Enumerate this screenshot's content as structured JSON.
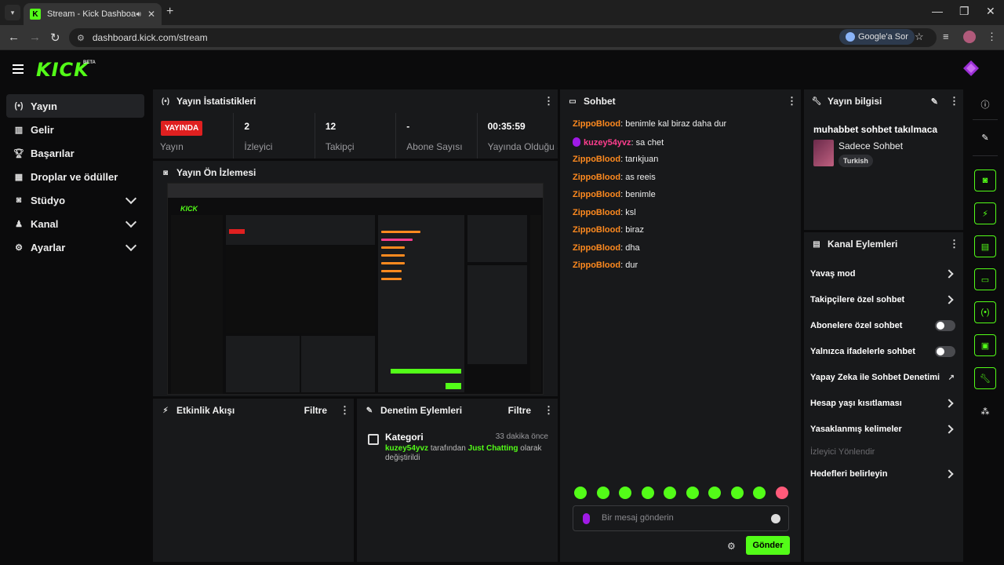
{
  "browser": {
    "tab_title": "Stream - Kick Dashboard",
    "url": "dashboard.kick.com/stream",
    "google_ask": "Google'a Sor"
  },
  "brand": {
    "logo": "KICK",
    "beta": "BETA",
    "accent": "#53fc18",
    "live_color": "#e02020"
  },
  "sidebar": {
    "items": [
      {
        "label": "Yayın",
        "icon": "broadcast-icon"
      },
      {
        "label": "Gelir",
        "icon": "chart-icon"
      },
      {
        "label": "Başarılar",
        "icon": "trophy-icon"
      },
      {
        "label": "Droplar ve ödüller",
        "icon": "gift-icon"
      },
      {
        "label": "Stüdyo",
        "icon": "studio-icon"
      },
      {
        "label": "Kanal",
        "icon": "users-icon"
      },
      {
        "label": "Ayarlar",
        "icon": "gear-icon"
      }
    ]
  },
  "stats_panel": {
    "title": "Yayın İstatistikleri",
    "live_badge": "YAYINDA",
    "live_label": "Yayın",
    "items": [
      {
        "value": "2",
        "label": "İzleyici"
      },
      {
        "value": "12",
        "label": "Takipçi"
      },
      {
        "value": "-",
        "label": "Abone Sayısı"
      },
      {
        "value": "00:35:59",
        "label": "Yayında Olduğu Süre"
      }
    ]
  },
  "preview_panel": {
    "title": "Yayın Ön İzlemesi"
  },
  "activity_panel": {
    "title": "Etkinlik Akışı",
    "filter": "Filtre"
  },
  "audit_panel": {
    "title": "Denetim Eylemleri",
    "filter": "Filtre",
    "entry": {
      "title": "Kategori",
      "time": "33 dakika önce",
      "user": "kuzey54yvz",
      "mid": " tarafından ",
      "category": "Just Chatting",
      "end": " olarak değiştirildi"
    }
  },
  "chat_panel": {
    "title": "Sohbet",
    "messages": [
      {
        "user": "ZippoBlood",
        "text": ": benimle kal biraz daha dur"
      },
      {
        "user": "kuzey54yvz",
        "text": ": sa chet"
      },
      {
        "user": "ZippoBlood",
        "text": ": tarıkjuan"
      },
      {
        "user": "ZippoBlood",
        "text": ": as reeis"
      },
      {
        "user": "ZippoBlood",
        "text": ": benimle"
      },
      {
        "user": "ZippoBlood",
        "text": ": ksl"
      },
      {
        "user": "ZippoBlood",
        "text": ": biraz"
      },
      {
        "user": "ZippoBlood",
        "text": ": dha"
      },
      {
        "user": "ZippoBlood",
        "text": ": dur"
      }
    ],
    "placeholder": "Bir mesaj gönderin",
    "send": "Gönder"
  },
  "info_panel": {
    "title": "Yayın bilgisi",
    "stream_title": "muhabbet sohbet takılmaca",
    "category": "Sadece Sohbet",
    "tag": "Turkish"
  },
  "channel_actions": {
    "title": "Kanal Eylemleri",
    "items": [
      {
        "label": "Yavaş mod",
        "control": "arrow"
      },
      {
        "label": "Takipçilere özel sohbet",
        "control": "arrow"
      },
      {
        "label": "Abonelere özel sohbet",
        "control": "toggle"
      },
      {
        "label": "Yalnızca ifadelerle sohbet",
        "control": "toggle"
      },
      {
        "label": "Yapay Zeka ile Sohbet Denetimi",
        "control": "external"
      },
      {
        "label": "Hesap yaşı kısıtlaması",
        "control": "arrow"
      },
      {
        "label": "Yasaklanmış kelimeler",
        "control": "arrow"
      },
      {
        "label": "İzleyici Yönlendir",
        "control": "none"
      },
      {
        "label": "Hedefleri belirleyin",
        "control": "arrow"
      }
    ]
  }
}
